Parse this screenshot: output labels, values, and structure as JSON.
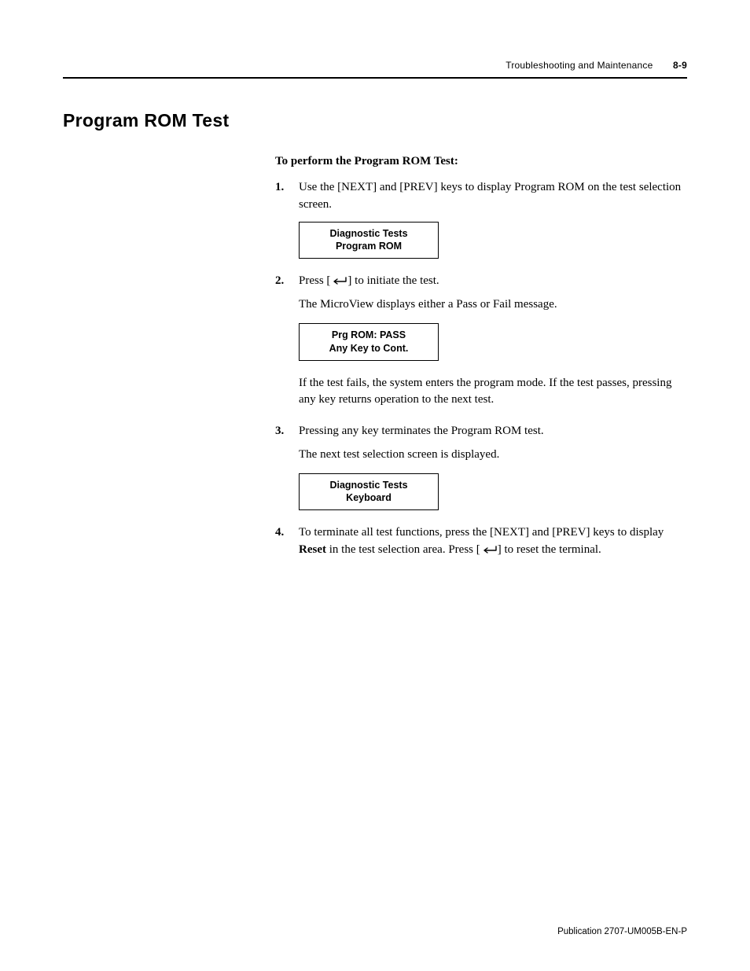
{
  "header": {
    "chapter": "Troubleshooting and Maintenance",
    "page": "8-9"
  },
  "title": "Program ROM Test",
  "lead": "To perform the Program ROM Test:",
  "steps": {
    "s1": "Use the [NEXT] and [PREV] keys to display Program ROM on the test selection screen.",
    "s2a": "Press [",
    "s2b": "] to initiate the test.",
    "s2_p1": "The MicroView displays either a Pass or Fail message.",
    "s2_p2": "If the test fails, the system enters the program mode. If the test passes, pressing any key returns operation to the next test.",
    "s3a": "Pressing any key terminates the Program ROM test.",
    "s3b": "The next test selection screen is displayed.",
    "s4a": "To terminate all test functions, press the [NEXT] and [PREV] keys to display ",
    "s4_reset": "Reset",
    "s4b": " in the test selection area. Press [",
    "s4c": "] to reset the terminal."
  },
  "screens": {
    "box1_l1": "Diagnostic Tests",
    "box1_l2": "Program ROM",
    "box2_l1": "Prg  ROM: PASS",
    "box2_l2": "Any Key to  Cont.",
    "box3_l1": "Diagnostic Tests",
    "box3_l2": "Keyboard"
  },
  "footer": "Publication 2707-UM005B-EN-P"
}
